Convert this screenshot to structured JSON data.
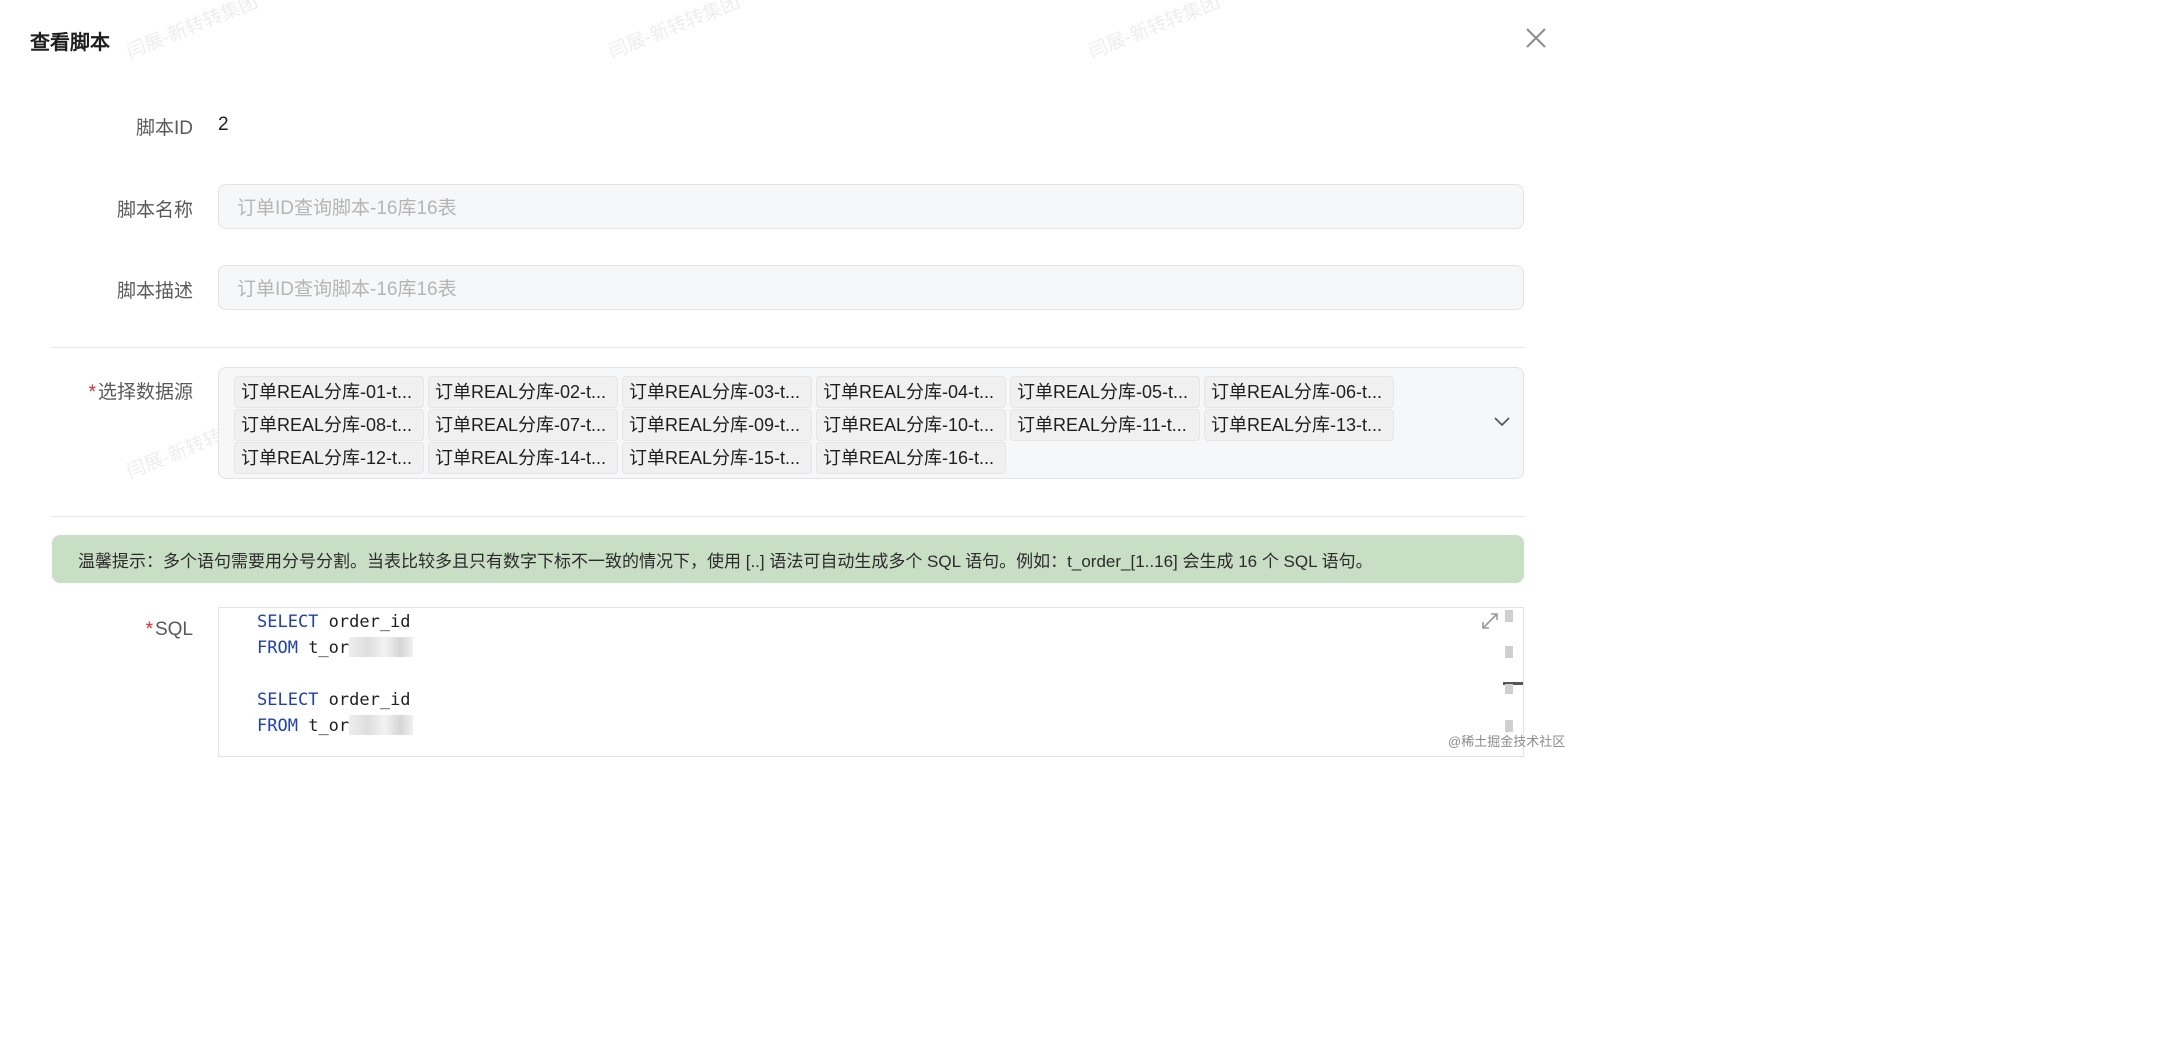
{
  "dialog": {
    "title": "查看脚本"
  },
  "watermark": {
    "text": "闫展-新转转集团"
  },
  "fields": {
    "script_id": {
      "label": "脚本ID",
      "value": "2"
    },
    "script_name": {
      "label": "脚本名称",
      "placeholder": "订单ID查询脚本-16库16表"
    },
    "script_desc": {
      "label": "脚本描述",
      "placeholder": "订单ID查询脚本-16库16表"
    },
    "datasource": {
      "required_mark": "*",
      "label": "选择数据源",
      "tags": [
        "订单REAL分库-01-t...",
        "订单REAL分库-02-t...",
        "订单REAL分库-03-t...",
        "订单REAL分库-04-t...",
        "订单REAL分库-05-t...",
        "订单REAL分库-06-t...",
        "订单REAL分库-08-t...",
        "订单REAL分库-07-t...",
        "订单REAL分库-09-t...",
        "订单REAL分库-10-t...",
        "订单REAL分库-11-t...",
        "订单REAL分库-13-t...",
        "订单REAL分库-12-t...",
        "订单REAL分库-14-t...",
        "订单REAL分库-15-t...",
        "订单REAL分库-16-t..."
      ]
    },
    "sql": {
      "required_mark": "*",
      "label": "SQL",
      "lines": [
        {
          "keyword": "SELECT",
          "rest": " order_id",
          "redacted": false
        },
        {
          "keyword": "FROM",
          "rest": " t_or",
          "redacted": true
        },
        {
          "keyword": "",
          "rest": "",
          "redacted": false
        },
        {
          "keyword": "SELECT",
          "rest": " order_id",
          "redacted": false
        },
        {
          "keyword": "FROM",
          "rest": " t_or",
          "redacted": true
        }
      ]
    }
  },
  "notice": {
    "text": "温馨提示：多个语句需要用分号分割。当表比较多且只有数字下标不一致的情况下，使用 [..] 语法可自动生成多个 SQL 语句。例如：t_order_[1..16] 会生成 16 个 SQL 语句。"
  },
  "footer": {
    "text": "@稀土掘金技术社区"
  },
  "icons": {
    "close": "close-icon",
    "chevron": "chevron-down-icon",
    "expand": "expand-icon"
  }
}
